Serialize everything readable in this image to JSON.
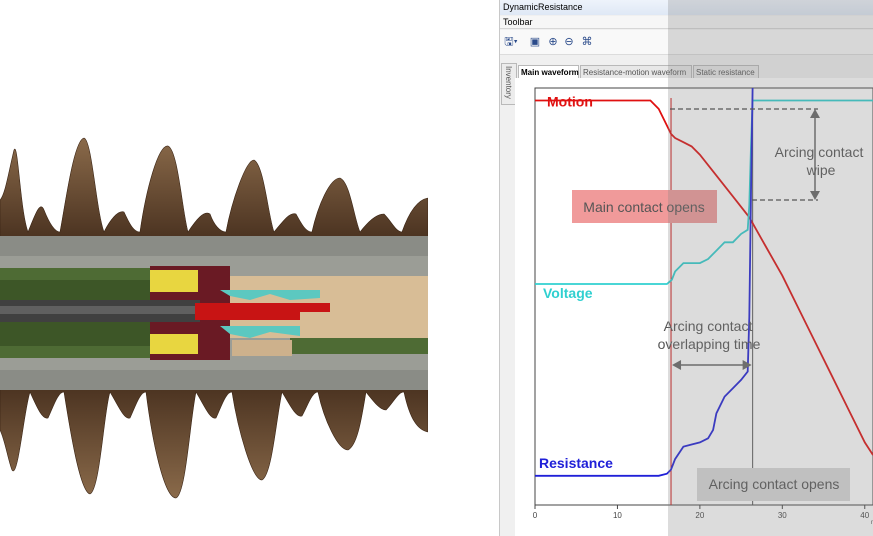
{
  "window": {
    "title": "DynamicResistance"
  },
  "toolbar": {
    "label": "Toolbar",
    "icons": [
      "save-dropdown-icon",
      "export-icon",
      "zoom-in-icon",
      "zoom-out-icon",
      "fit-icon"
    ]
  },
  "sidebar": {
    "tab_label": "Inventory"
  },
  "tabs": [
    {
      "label": "Main waveform",
      "active": true
    },
    {
      "label": "Resistance-motion waveform",
      "active": false
    },
    {
      "label": "Static resistance",
      "active": false
    }
  ],
  "annotations": {
    "main_contact_opens": "Main contact opens",
    "arcing_contact_wipe": "Arcing contact wipe",
    "overlap_line1": "Arcing contact",
    "overlap_line2": "overlapping time",
    "arcing_contact_opens": "Arcing contact opens"
  },
  "chart_data": {
    "type": "line",
    "xlim": [
      0,
      41
    ],
    "ticks": [
      0,
      10,
      20,
      30,
      40
    ],
    "x_unit_fragment": "n",
    "series": [
      {
        "name": "Motion",
        "color": "#e01010",
        "x": [
          0,
          14,
          15,
          16,
          16.5,
          17,
          18,
          19,
          20,
          22,
          24,
          26,
          28,
          30,
          32,
          34,
          36,
          38,
          40,
          41
        ],
        "y": [
          0.97,
          0.97,
          0.95,
          0.91,
          0.89,
          0.88,
          0.87,
          0.86,
          0.84,
          0.79,
          0.74,
          0.69,
          0.62,
          0.55,
          0.47,
          0.39,
          0.31,
          0.23,
          0.15,
          0.12
        ]
      },
      {
        "name": "Voltage",
        "color": "#30d0d0",
        "x": [
          0,
          16,
          16.6,
          17,
          18,
          19,
          20,
          21,
          22,
          23,
          24,
          25,
          25.8,
          26,
          26.2,
          26.4,
          41
        ],
        "y": [
          0.53,
          0.53,
          0.54,
          0.56,
          0.58,
          0.58,
          0.58,
          0.59,
          0.61,
          0.63,
          0.63,
          0.65,
          0.66,
          0.72,
          0.86,
          0.97,
          0.97
        ]
      },
      {
        "name": "Resistance",
        "color": "#2020d8",
        "x": [
          0,
          15,
          16,
          16.5,
          17,
          18,
          19,
          20,
          21,
          21.6,
          22,
          23,
          24,
          25,
          25.8,
          26,
          26.2,
          26.4
        ],
        "y": [
          0.07,
          0.07,
          0.075,
          0.085,
          0.11,
          0.14,
          0.145,
          0.15,
          0.16,
          0.18,
          0.22,
          0.26,
          0.28,
          0.3,
          0.32,
          0.45,
          0.75,
          1.0
        ]
      }
    ],
    "markers": {
      "main_contact_x": 16.5,
      "arcing_contact_x": 26.4
    }
  }
}
